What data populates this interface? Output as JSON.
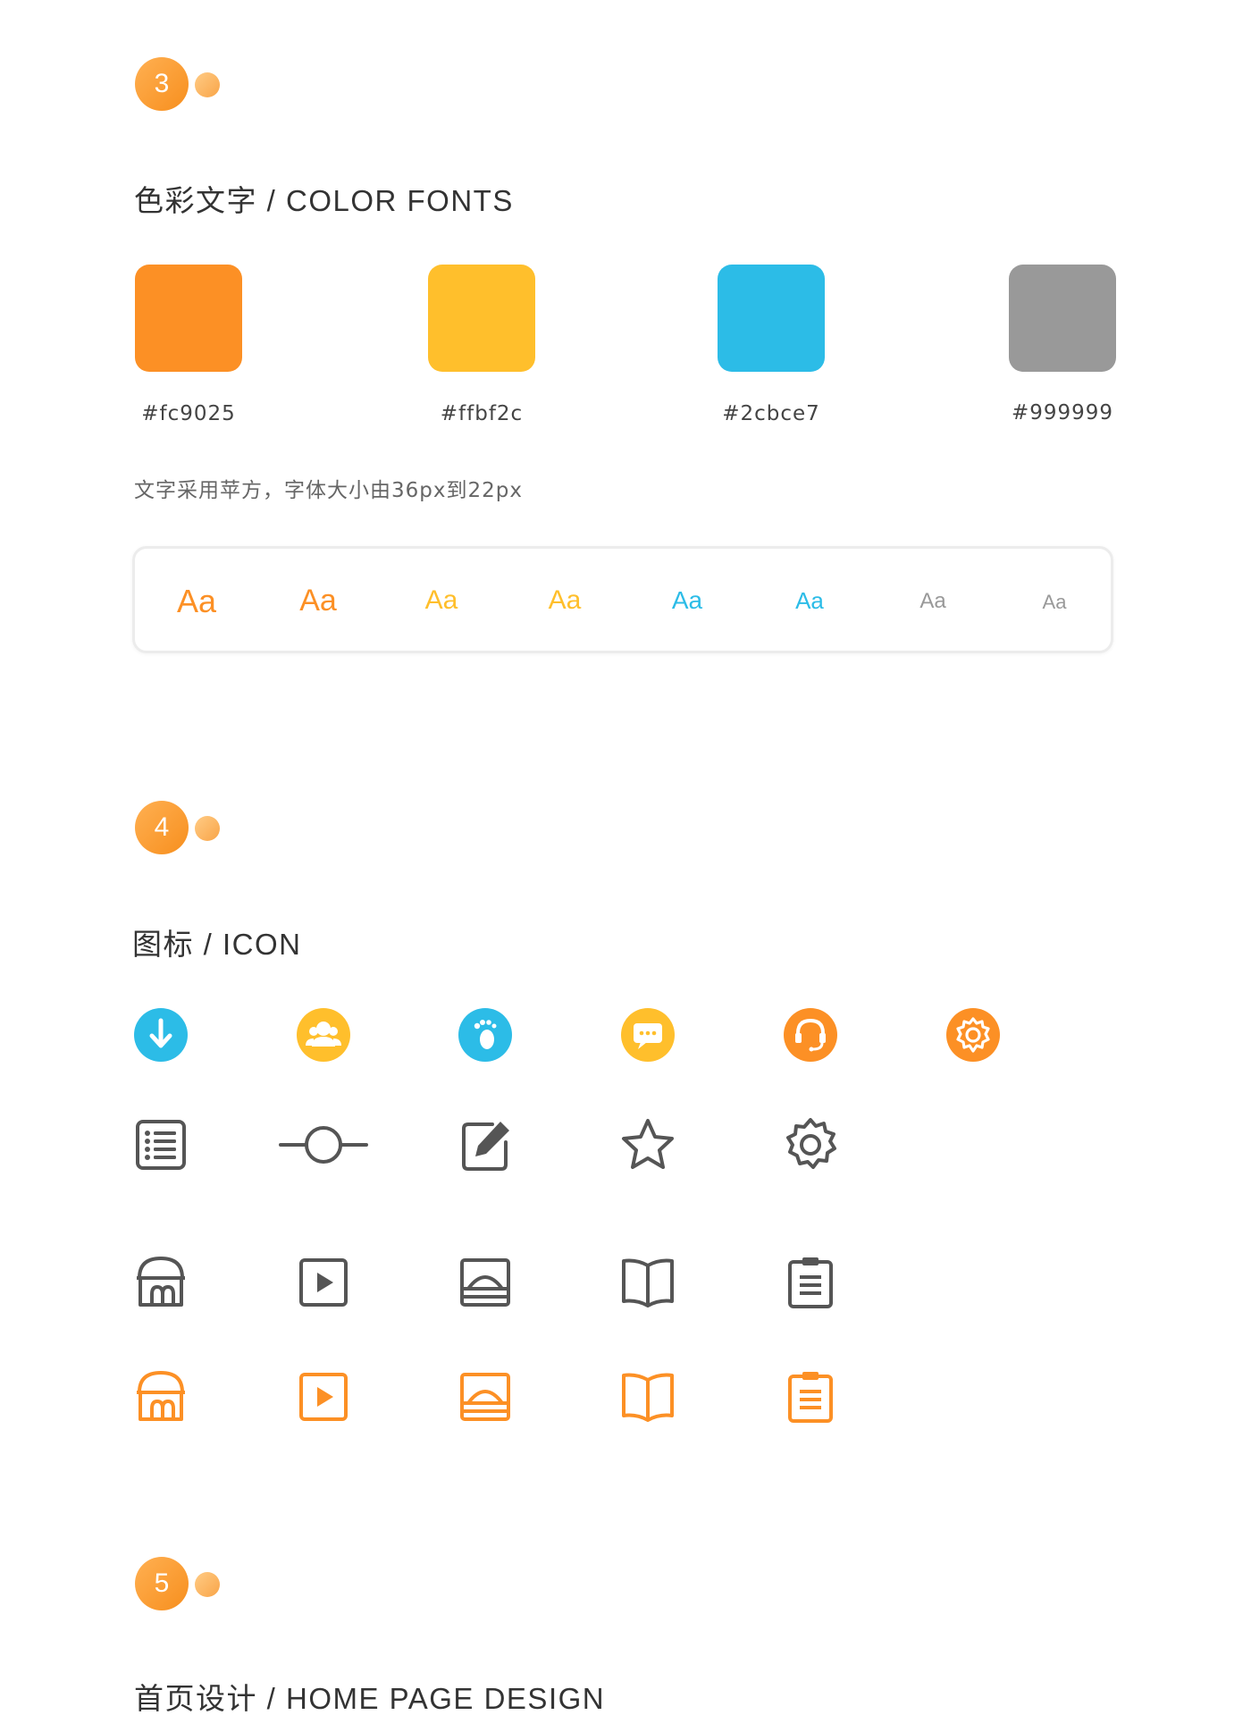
{
  "section3": {
    "number": "3",
    "title": "色彩文字 / COLOR FONTS",
    "swatches": [
      {
        "hex": "#fc9025",
        "label": "#fc9025"
      },
      {
        "hex": "#ffbf2c",
        "label": "#ffbf2c"
      },
      {
        "hex": "#2cbce7",
        "label": "#2cbce7"
      },
      {
        "hex": "#999999",
        "label": "#999999"
      }
    ],
    "description": "文字采用苹方，字体大小由36px到22px",
    "font_samples": [
      {
        "text": "Aa",
        "color": "#fc9025"
      },
      {
        "text": "Aa",
        "color": "#fc9025"
      },
      {
        "text": "Aa",
        "color": "#ffbf2c"
      },
      {
        "text": "Aa",
        "color": "#ffbf2c"
      },
      {
        "text": "Aa",
        "color": "#2cbce7"
      },
      {
        "text": "Aa",
        "color": "#2cbce7"
      },
      {
        "text": "Aa",
        "color": "#999999"
      },
      {
        "text": "Aa",
        "color": "#999999"
      }
    ]
  },
  "section4": {
    "number": "4",
    "title": "图标 / ICON",
    "row1_icons": [
      "download-icon",
      "user-group-icon",
      "footprint-icon",
      "chat-bubble-icon",
      "headset-icon",
      "settings-icon"
    ],
    "row2_icons": [
      "list-icon",
      "slider-icon",
      "edit-icon",
      "star-icon",
      "gear-icon"
    ],
    "row3_icons": [
      "shop-icon",
      "video-icon",
      "landscape-icon",
      "book-icon",
      "clipboard-icon"
    ],
    "row4_icons": [
      "shop-icon",
      "video-icon",
      "landscape-icon",
      "book-icon",
      "clipboard-icon"
    ],
    "colors": {
      "dark": "#555555",
      "accent": "#fc9025"
    }
  },
  "section5": {
    "number": "5",
    "title": "首页设计 / HOME PAGE DESIGN"
  }
}
